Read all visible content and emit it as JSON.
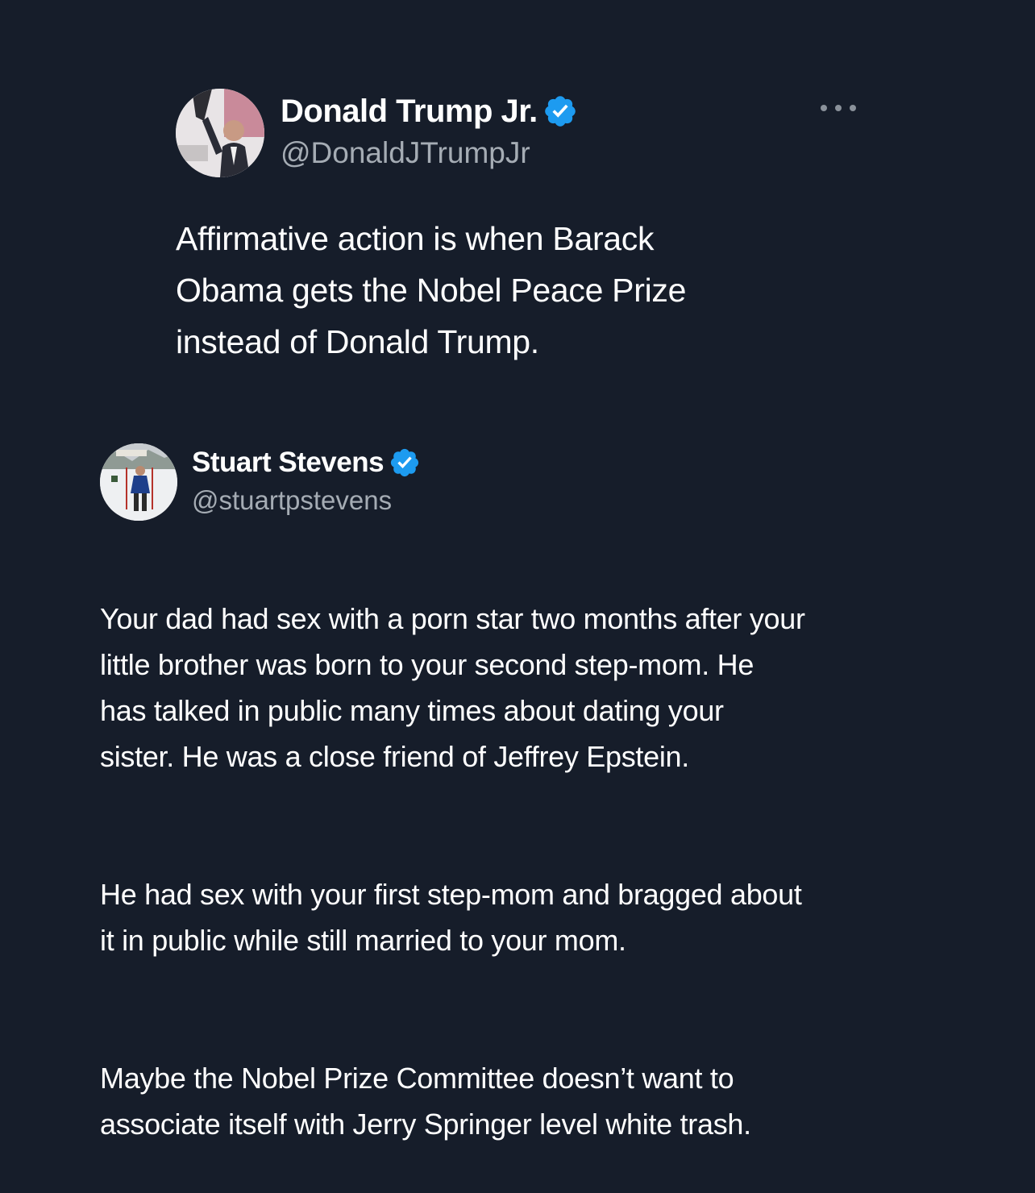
{
  "original_tweet": {
    "display_name": "Donald Trump Jr.",
    "handle": "@DonaldJTrumpJr",
    "verified": true,
    "avatar": "profile-photo",
    "more_icon": "more-icon",
    "text": "Affirmative action is when Barack\nObama gets the Nobel Peace Prize\ninstead of Donald Trump."
  },
  "reply_tweet": {
    "display_name": "Stuart Stevens",
    "handle": "@stuartpstevens",
    "verified": true,
    "avatar": "profile-photo",
    "paragraphs": [
      "Your dad had sex with a porn star two months after your\nlittle brother was born to your second step-mom. He\nhas talked in public many times about dating your\nsister. He was a close friend of Jeffrey Epstein.",
      "He had sex with your first step-mom and bragged about\nit in public while still married to your mom.",
      "Maybe the Nobel Prize Committee doesn’t want to\nassociate itself with Jerry Springer level white trash."
    ]
  },
  "colors": {
    "background": "#161d2a",
    "text_primary": "#ffffff",
    "text_secondary": "#a5acb4",
    "verified_badge": "#1d9bf0"
  }
}
